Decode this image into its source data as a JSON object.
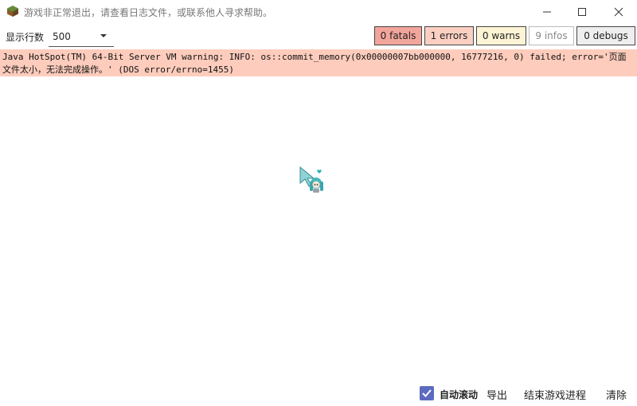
{
  "window": {
    "title": "游戏非正常退出，请查看日志文件，或联系他人寻求帮助。",
    "icon": "grass-block-icon"
  },
  "toolbar": {
    "rows_label": "显示行数",
    "rows_value": "500",
    "filters": {
      "fatals": "0 fatals",
      "errors": "1 errors",
      "warns": "0 warns",
      "infos": "9 infos",
      "debugs": "0 debugs"
    }
  },
  "colors": {
    "fatals_bg": "#f2a59b",
    "errors_bg": "#fbd0c3",
    "warns_bg": "#fdf4d5",
    "infos_bg": "#ffffff",
    "debugs_bg": "#eeeeee",
    "log_error_bg": "#fdccbc",
    "checkbox": "#5c6bc0"
  },
  "log": {
    "lines": [
      "Java HotSpot(TM) 64-Bit Server VM warning: INFO: os::commit_memory(0x00000007bb000000, 16777216, 0) failed; error='页面文件太小，无法完成操作。' (DOS error/errno=1455)"
    ]
  },
  "bottom": {
    "auto_scroll_label": "自动滚动",
    "auto_scroll_checked": true,
    "export_label": "导出",
    "kill_label": "结束游戏进程",
    "clear_label": "清除"
  }
}
